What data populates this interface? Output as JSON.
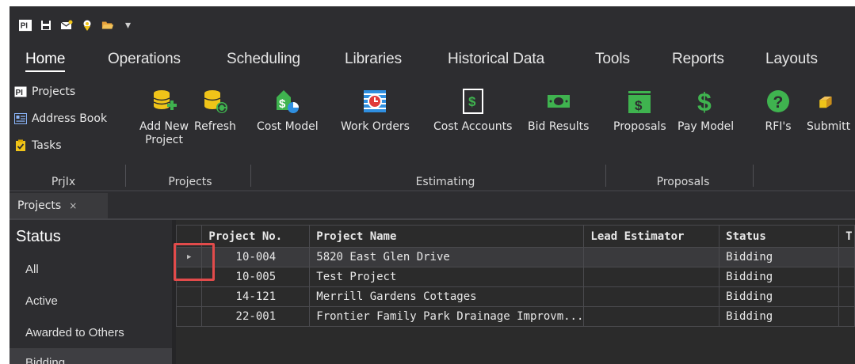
{
  "quick_access": {
    "logo": "PI",
    "icons": [
      "save-icon",
      "email-icon",
      "map-pin-icon",
      "folder-open-icon"
    ],
    "caret": "▾"
  },
  "menu_tabs": [
    "Home",
    "Operations",
    "Scheduling",
    "Libraries",
    "Historical Data",
    "Tools",
    "Reports",
    "Layouts"
  ],
  "ribbon": {
    "prjix": {
      "items": [
        {
          "icon": "PI",
          "label": "Projects"
        },
        {
          "icon": "address-book-icon",
          "label": "Address Book"
        },
        {
          "icon": "tasks-icon",
          "label": "Tasks"
        }
      ],
      "group_label": "PrjIx"
    },
    "projects": {
      "add_new_line1": "Add New",
      "add_new_line2": "Project",
      "refresh": "Refresh",
      "group_label": "Projects"
    },
    "estimating": {
      "cost_model": "Cost Model",
      "work_orders": "Work Orders",
      "cost_accounts": "Cost Accounts",
      "bid_results": "Bid Results",
      "group_label": "Estimating"
    },
    "proposals": {
      "proposals": "Proposals",
      "pay_model": "Pay Model",
      "group_label": "Proposals"
    },
    "more": {
      "rfis": "RFI's",
      "submittals": "Submitt"
    }
  },
  "doc_tab": {
    "label": "Projects",
    "close": "×"
  },
  "sidebar": {
    "title": "Status",
    "items": [
      "All",
      "Active",
      "Awarded to Others",
      "Bidding"
    ]
  },
  "grid": {
    "columns": [
      "Project No.",
      "Project Name",
      "Lead Estimator",
      "Status",
      "T"
    ],
    "rows": [
      {
        "indicator": "▶",
        "project_no": "10-004",
        "project_name": "5820 East Glen Drive",
        "lead_estimator": "",
        "status": "Bidding"
      },
      {
        "indicator": "",
        "project_no": "10-005",
        "project_name": "Test Project",
        "lead_estimator": "",
        "status": "Bidding"
      },
      {
        "indicator": "",
        "project_no": "14-121",
        "project_name": "Merrill Gardens Cottages",
        "lead_estimator": "",
        "status": "Bidding"
      },
      {
        "indicator": "",
        "project_no": "22-001",
        "project_name": "Frontier Family Park Drainage Improvm...",
        "lead_estimator": "",
        "status": "Bidding"
      }
    ]
  },
  "colors": {
    "background": "#2d2d30",
    "highlight_box": "#e24b4b",
    "icon_yellow": "#f0c419",
    "icon_green": "#3fb34f",
    "icon_blue": "#2f8fe0",
    "icon_red": "#e03a3a"
  }
}
